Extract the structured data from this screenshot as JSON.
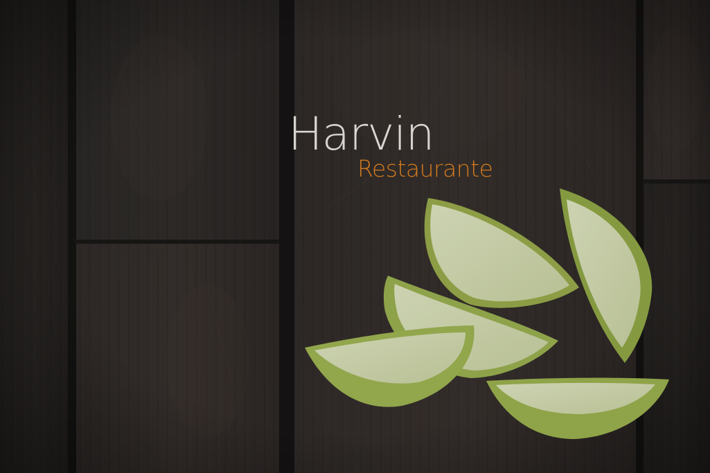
{
  "hero": {
    "title": "Harvin",
    "subtitle": "Restaurante"
  },
  "colors": {
    "overlay": "#1c1b1a",
    "title": "#d9d6d2",
    "subtitle_accent": "#d27a1e",
    "apple_skin": "#8fa24a",
    "apple_flesh": "#c9cfae"
  },
  "icons": {
    "background": "wooden-table-photo",
    "decoration": "green-apple-slices"
  }
}
